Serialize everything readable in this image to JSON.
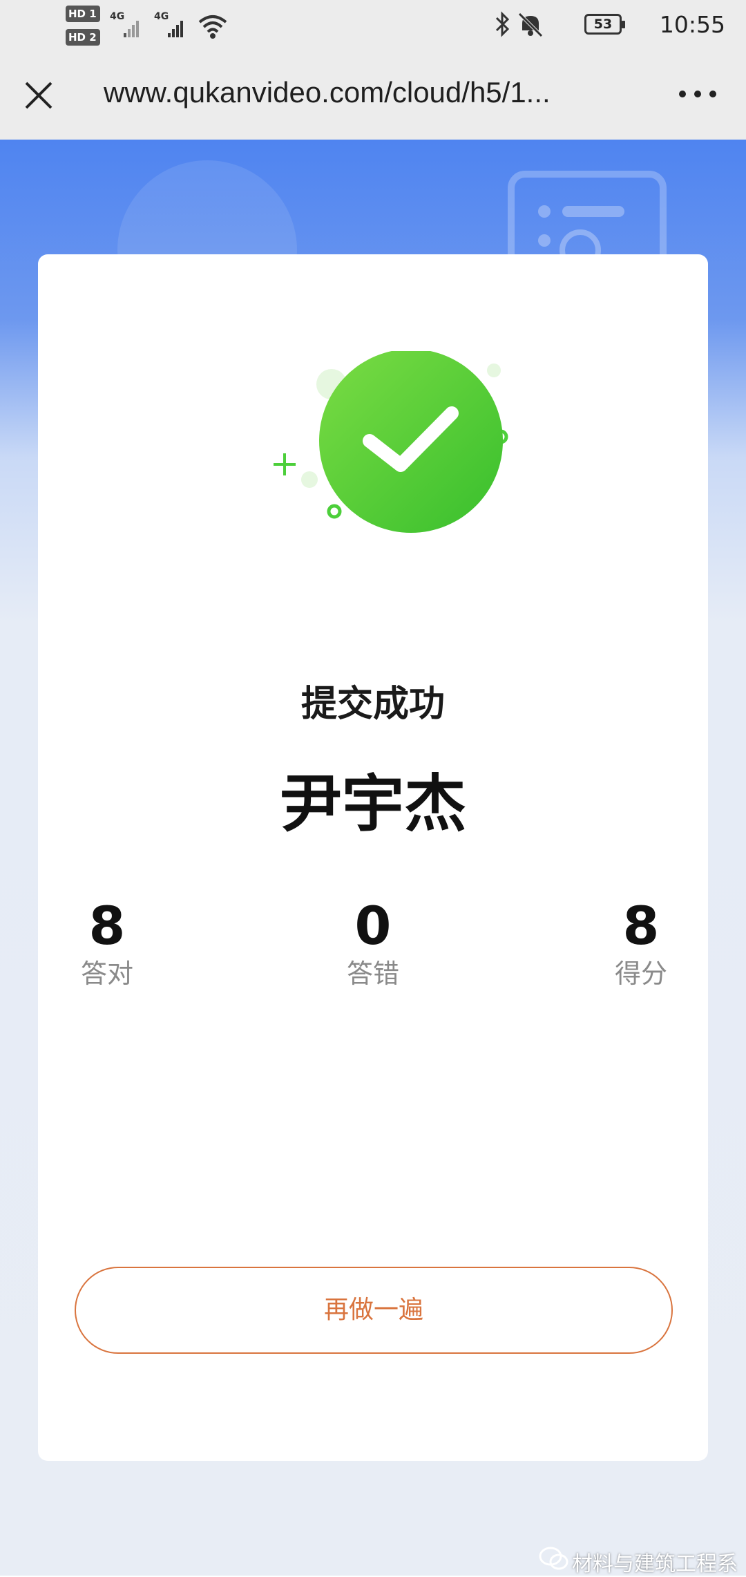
{
  "status_bar": {
    "sim1": "HD 1",
    "sim2": "HD 2",
    "net1": "4G",
    "net2": "4G",
    "battery": "53",
    "time": "10:55"
  },
  "browser": {
    "url": "www.qukanvideo.com/cloud/h5/1..."
  },
  "result": {
    "title": "提交成功",
    "name": "尹宇杰",
    "stats": [
      {
        "value": "8",
        "label": "答对"
      },
      {
        "value": "0",
        "label": "答错"
      },
      {
        "value": "8",
        "label": "得分"
      }
    ]
  },
  "actions": {
    "redo_label": "再做一遍"
  },
  "watermark": "材料与建筑工程系",
  "colors": {
    "accent": "#d9743e",
    "success": "#4ccf3a",
    "header_blue": "#4f84f0"
  }
}
